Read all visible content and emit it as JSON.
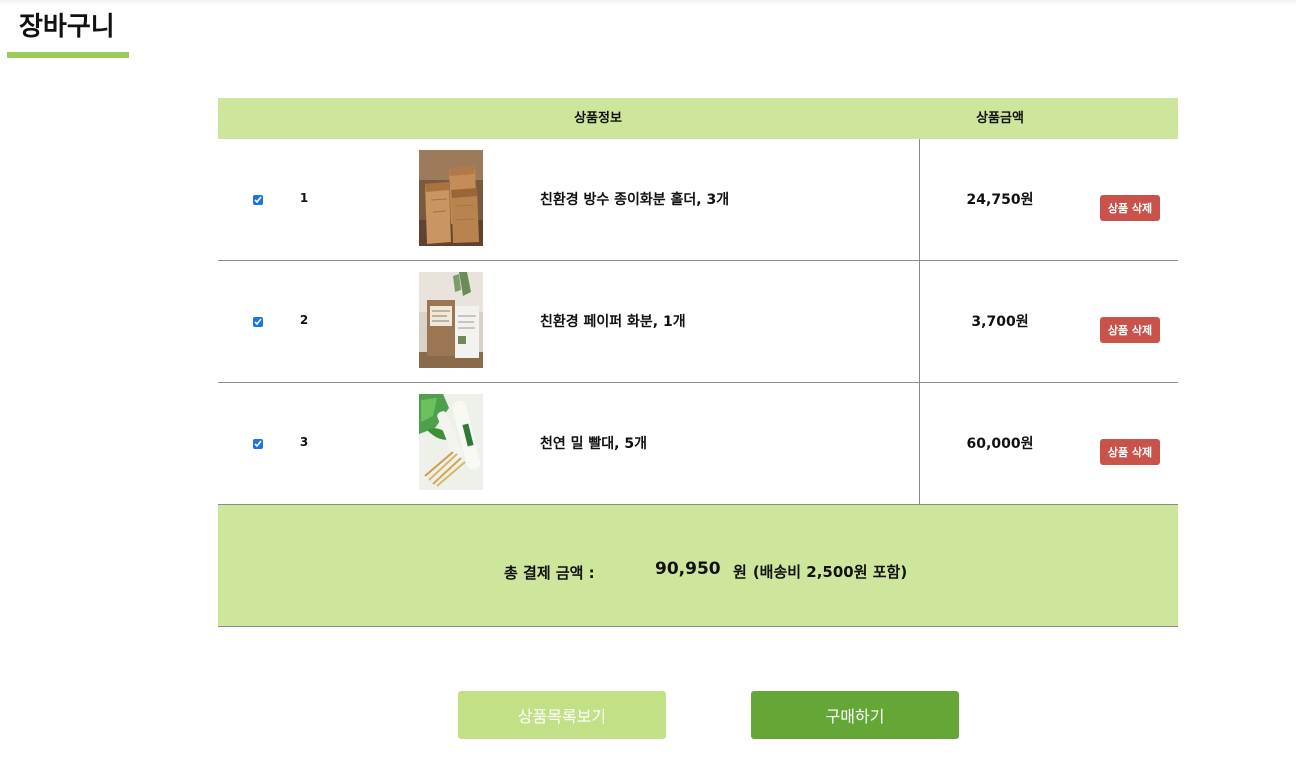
{
  "page": {
    "title": "장바구니"
  },
  "cart": {
    "headers": {
      "product_info": "상품정보",
      "price": "상품금액"
    },
    "items": [
      {
        "num": "1",
        "checked": true,
        "name": "친환경 방수 종이화분 홀더, 3개",
        "price": "24,750원",
        "delete_label": "상품 삭제",
        "thumb": "brown-paper-planters"
      },
      {
        "num": "2",
        "checked": true,
        "name": "친환경 페이퍼 화분, 1개",
        "price": "3,700원",
        "delete_label": "상품 삭제",
        "thumb": "paper-pot-with-tag"
      },
      {
        "num": "3",
        "checked": true,
        "name": "천연 밀 빨대, 5개",
        "price": "60,000원",
        "delete_label": "상품 삭제",
        "thumb": "wheat-straws-with-leaves"
      }
    ],
    "total": {
      "label": "총 결제 금액 :",
      "amount": "90,950",
      "won": "원",
      "shipping_note": "(배송비 2,500원 포함)"
    }
  },
  "actions": {
    "list_label": "상품목록보기",
    "buy_label": "구매하기"
  },
  "colors": {
    "accent_green": "#99cc5a",
    "header_bg": "#cee69c",
    "delete_red": "#c9534b",
    "list_button": "#c2e187",
    "buy_button": "#65a737"
  }
}
